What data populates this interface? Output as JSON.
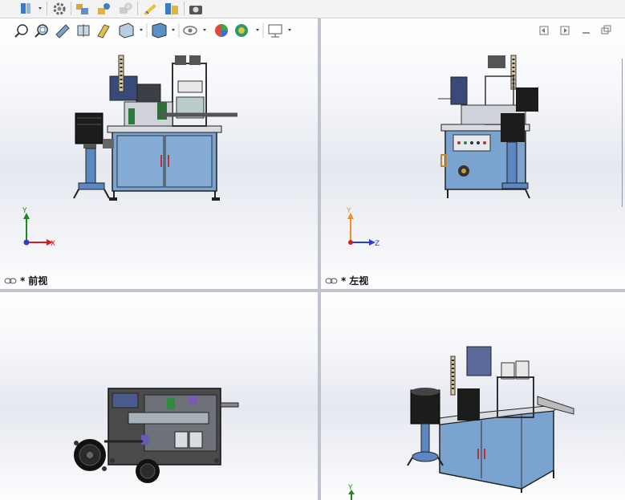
{
  "viewports": {
    "front": {
      "label": "前视",
      "modified": "*"
    },
    "left": {
      "label": "左视",
      "modified": "*"
    },
    "top": {
      "label": ""
    },
    "iso": {
      "label": ""
    }
  },
  "triad": {
    "x": "X",
    "y": "Y",
    "z": "Z"
  },
  "colors": {
    "cabinet": "#7aa3cf",
    "frame": "#8b939c",
    "dark": "#1b1b1b",
    "triad_x": "#d02020",
    "triad_y": "#1e8a1e",
    "triad_z": "#2a3fd0",
    "triad_y_alt": "#e8902a"
  },
  "toolbar_icons": [
    "pin-icon",
    "gear-icon",
    "assembly-icon",
    "mate-icon",
    "smart-fastener-icon",
    "design-library-icon",
    "ruler-icon",
    "camera-icon"
  ],
  "heads_up_icons": [
    "zoom-to-fit-icon",
    "zoom-to-area-icon",
    "previous-view-icon",
    "section-view-icon",
    "dynamic-annotation-icon",
    "display-style-icon",
    "view-orientation-icon",
    "hide-show-icon",
    "edit-appearance-icon",
    "apply-scene-icon",
    "view-settings-icon"
  ],
  "window_icons": [
    "tile-left-icon",
    "tile-right-icon",
    "minimize-icon",
    "restore-icon"
  ]
}
